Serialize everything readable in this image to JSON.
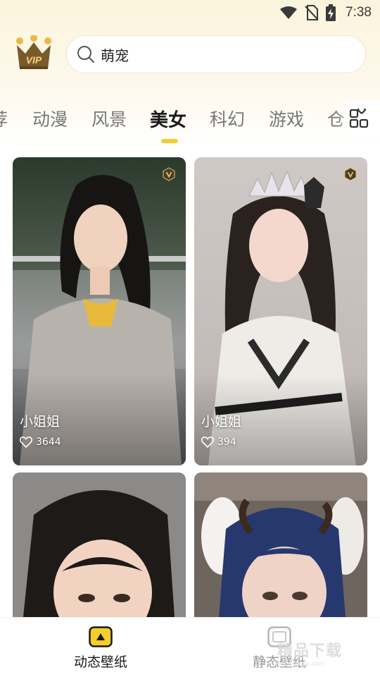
{
  "status_bar": {
    "time": "7:38",
    "icons": [
      "wifi-icon",
      "no-sim-icon",
      "battery-charging-icon"
    ]
  },
  "header": {
    "vip_badge_text": "VIP",
    "search": {
      "value": "萌宠",
      "icon": "search-icon"
    }
  },
  "tabs": {
    "items": [
      {
        "label": "荐"
      },
      {
        "label": "动漫"
      },
      {
        "label": "风景"
      },
      {
        "label": "美女"
      },
      {
        "label": "科幻"
      },
      {
        "label": "游戏"
      },
      {
        "label": "仓"
      }
    ],
    "active_index": 3,
    "indicator_color": "#f5cd2e",
    "more_icon": "grid-icon"
  },
  "cards": [
    {
      "title": "小姐姐",
      "likes": "3644",
      "vip": true,
      "icon": "heart-outline-icon"
    },
    {
      "title": "小姐姐",
      "likes": "394",
      "vip": true,
      "icon": "heart-outline-icon"
    },
    {
      "title": "",
      "likes": "",
      "vip": false
    },
    {
      "title": "",
      "likes": "",
      "vip": false
    }
  ],
  "bottom_nav": {
    "items": [
      {
        "label": "动态壁纸",
        "icon": "live-wallpaper-icon",
        "active": true
      },
      {
        "label": "静态壁纸",
        "icon": "static-wallpaper-icon",
        "active": false
      }
    ]
  },
  "watermark": {
    "text": "精品下载",
    "url": "www.jpxjp.com"
  },
  "colors": {
    "accent": "#f5cd2e",
    "vip_brown": "#7a5a2a",
    "vip_gold": "#e9b947"
  }
}
